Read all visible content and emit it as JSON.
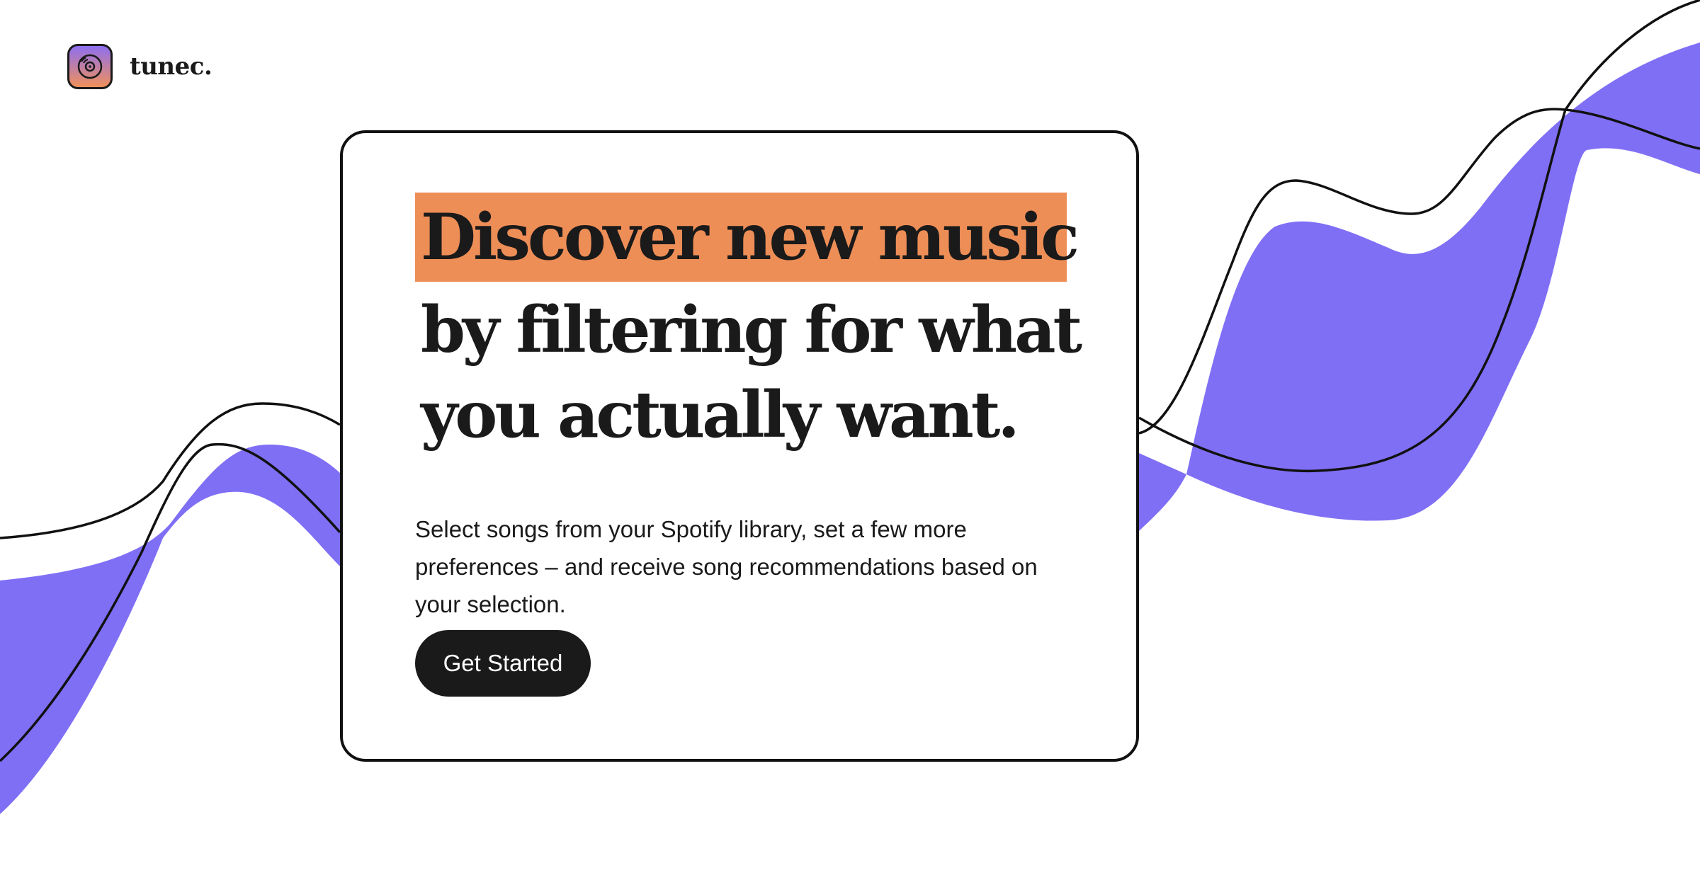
{
  "brand": {
    "name": "tunec.",
    "icon": "vinyl-disc-icon"
  },
  "hero": {
    "headline_highlight": "Discover new music",
    "headline_line2": "by filtering for what",
    "headline_line3": "you actually want.",
    "description": "Select songs from your Spotify library, set a few more preferences – and receive song recommendations based on your selection.",
    "cta_label": "Get Started"
  },
  "colors": {
    "accent_orange": "#ee8e57",
    "wave_purple": "#7f6ff5",
    "ink": "#1a1a1a",
    "background": "#ffffff"
  }
}
